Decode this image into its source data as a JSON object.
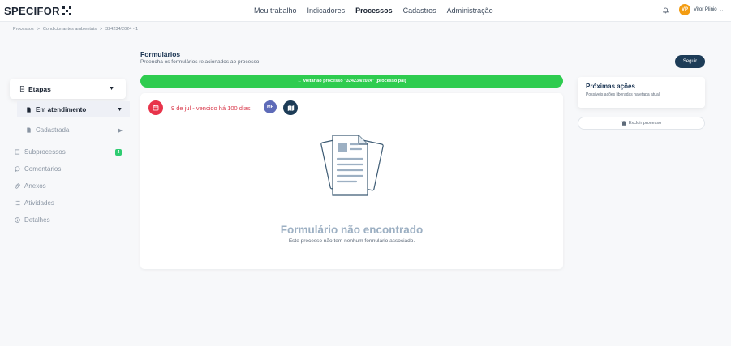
{
  "app": {
    "logo_text": "SPECIFOR"
  },
  "nav": {
    "items": [
      {
        "label": "Meu trabalho"
      },
      {
        "label": "Indicadores"
      },
      {
        "label": "Processos"
      },
      {
        "label": "Cadastros"
      },
      {
        "label": "Administração"
      }
    ],
    "active": "Processos"
  },
  "user": {
    "initials": "VP",
    "name": "Vitor Plinio"
  },
  "breadcrumb": [
    "Processos",
    ">",
    "Condicionantes ambientais",
    ">",
    "324234/2024 - 1"
  ],
  "sidebar": {
    "etapas_label": "Etapas",
    "em_atendimento_label": "Em atendimento",
    "cadastrada_label": "Cadastrada",
    "menu": [
      {
        "label": "Subprocessos",
        "icon": "subprocess-icon"
      },
      {
        "label": "Comentários",
        "icon": "comment-icon"
      },
      {
        "label": "Anexos",
        "icon": "paperclip-icon"
      },
      {
        "label": "Atividades",
        "icon": "list-icon"
      },
      {
        "label": "Detalhes",
        "icon": "info-icon"
      }
    ],
    "subprocessos_count": "4"
  },
  "main": {
    "title": "Formulários",
    "subtitle": "Preencha os formulários relacionados ao processo",
    "back_button": "← Voltar ao processo \"324234/2024\" (processo pai)",
    "due_text": "9 de jul - vencido há 100 dias",
    "assignee_initials": "MF",
    "empty_title": "Formulário não encontrado",
    "empty_sub": "Este processo não tem nenhum formulário associado."
  },
  "right": {
    "follow_label": "Seguir",
    "next_title": "Próximas ações",
    "next_sub": "Possíveis ações liberadas na etapa atual",
    "delete_label": "Excluir processo"
  },
  "colors": {
    "accent_green": "#2ecc4f",
    "navy": "#1d3c57",
    "danger": "#e8334a"
  }
}
